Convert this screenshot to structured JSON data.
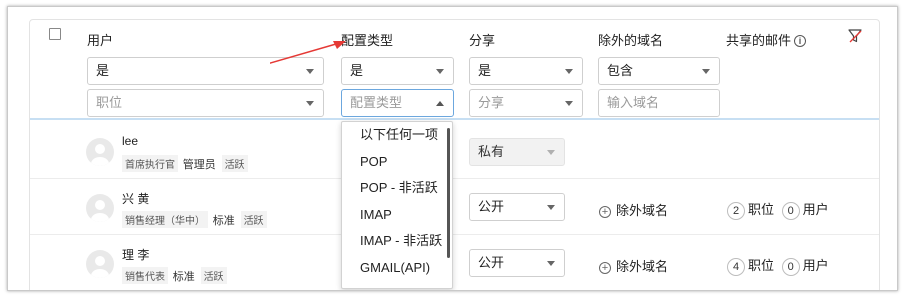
{
  "header": {
    "user_label": "用户",
    "config_type_label": "配置类型",
    "share_label": "分享",
    "excluded_domains_label": "除外的域名",
    "shared_mail_label": "共享的邮件",
    "info_icon": "i"
  },
  "filters": {
    "user_select": "是",
    "position_placeholder": "职位",
    "config_select": "是",
    "config_type_placeholder": "配置类型",
    "share_select": "是",
    "share_placeholder": "分享",
    "domain_select": "包含",
    "domain_placeholder": "输入域名"
  },
  "dropdown": {
    "options": [
      "以下任何一项",
      "POP",
      "POP - 非活跃",
      "IMAP",
      "IMAP - 非活跃",
      "GMAIL(API)"
    ]
  },
  "rows": [
    {
      "name": "lee",
      "title": "首席执行官",
      "role": "管理员",
      "status": "活跃",
      "share": "私有"
    },
    {
      "name": "兴 黄",
      "title": "销售经理（华中）",
      "role": "标准",
      "status": "活跃",
      "share": "公开",
      "exclude": "除外域名",
      "positions_count": "2",
      "positions_label": "职位",
      "users_count": "0",
      "users_label": "用户"
    },
    {
      "name": "理 李",
      "title": "销售代表",
      "role": "标准",
      "status": "活跃",
      "share": "公开",
      "exclude": "除外域名",
      "positions_count": "4",
      "positions_label": "职位",
      "users_count": "0",
      "users_label": "用户"
    }
  ],
  "colors": {
    "annotation_arrow": "#e53935",
    "active_border": "#6ca7de",
    "header_divider": "#c7dff3"
  }
}
